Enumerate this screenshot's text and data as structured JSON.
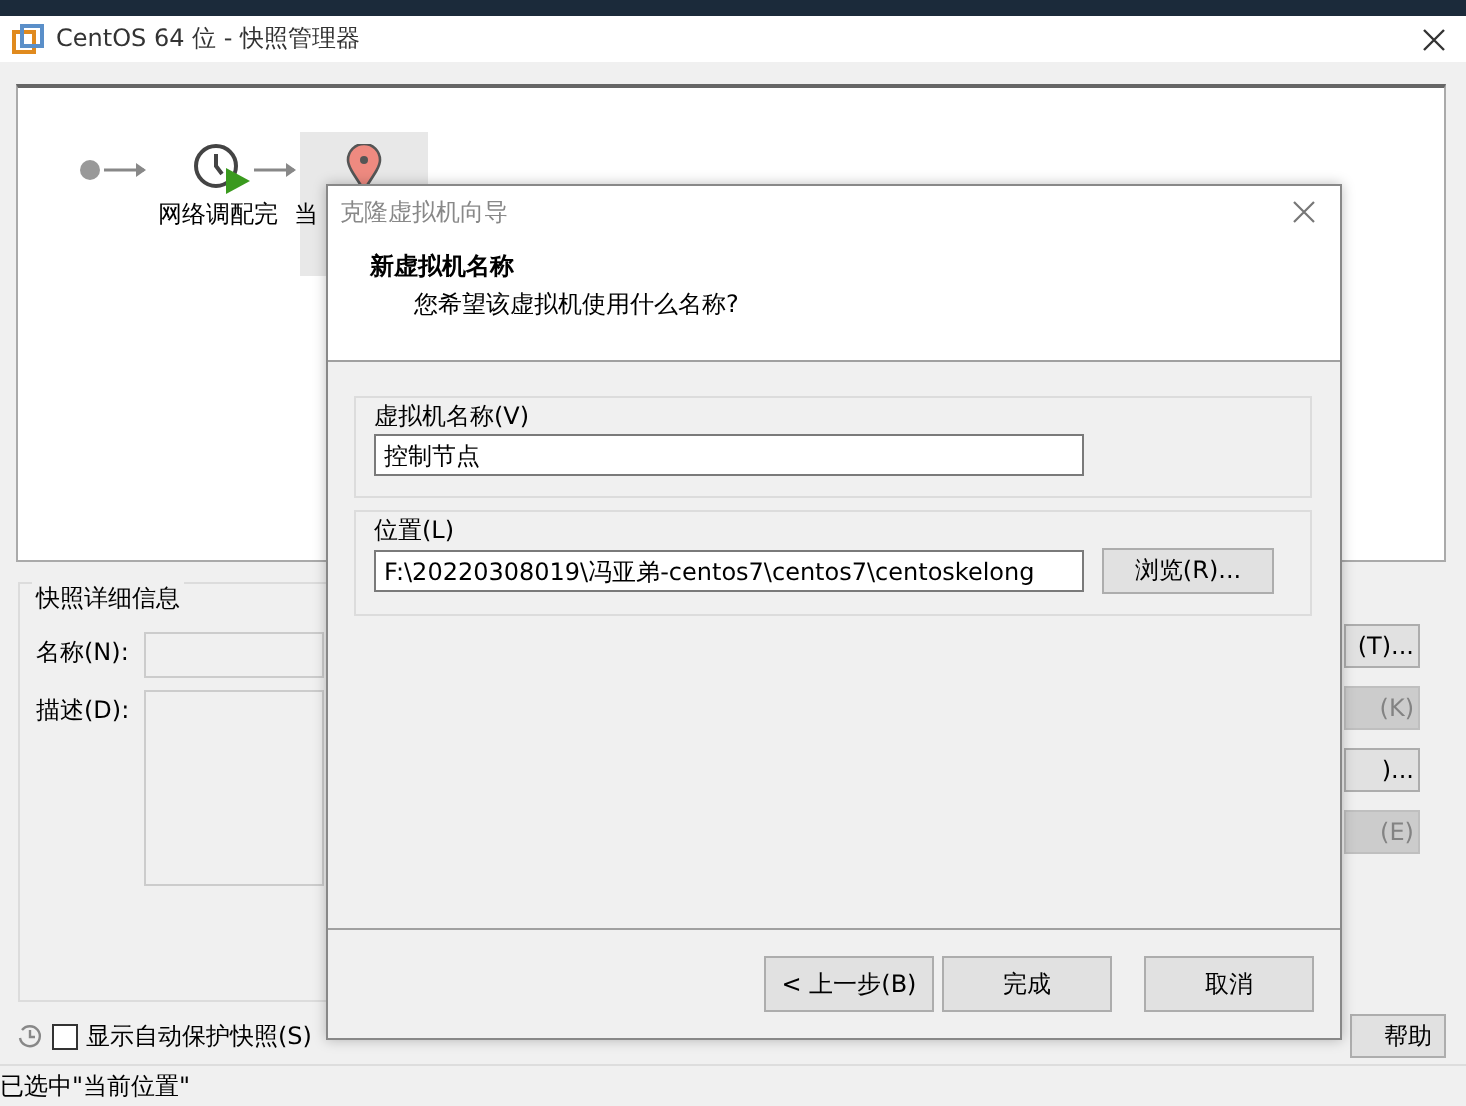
{
  "window": {
    "title": "CentOS 64 位 - 快照管理器"
  },
  "snapshot_tree": {
    "nodes": [
      {
        "kind": "start",
        "selected": false
      },
      {
        "kind": "snapshot",
        "label": "网络调配完",
        "selected": false
      },
      {
        "kind": "current",
        "label": "当",
        "selected": true
      }
    ]
  },
  "details": {
    "title": "快照详细信息",
    "name_label": "名称(N):",
    "description_label": "描述(D):"
  },
  "side_buttons": [
    {
      "label": "(T)...",
      "disabled": false
    },
    {
      "label": "(K)",
      "disabled": true
    },
    {
      "label": ")...",
      "disabled": false
    },
    {
      "label": "(E)",
      "disabled": true
    }
  ],
  "autosave": {
    "label": "显示自动保护快照(S)",
    "checked": false
  },
  "help_button": "帮助",
  "status_bar": "已选中\"当前位置\"",
  "dialog": {
    "title": "克隆虚拟机向导",
    "heading": "新虚拟机名称",
    "subheading": "您希望该虚拟机使用什么名称?",
    "groups": [
      {
        "kind": "name",
        "title": "虚拟机名称(V)",
        "value": "控制节点"
      },
      {
        "kind": "location",
        "title": "位置(L)",
        "value": "F:\\20220308019\\冯亚弟-centos7\\centos7\\centoskelong",
        "button": "浏览(R)..."
      }
    ],
    "buttons": [
      {
        "label": "< 上一步(B)",
        "kind": "back"
      },
      {
        "label": "完成",
        "kind": "finish"
      },
      {
        "label": "取消",
        "kind": "cancel"
      }
    ]
  }
}
